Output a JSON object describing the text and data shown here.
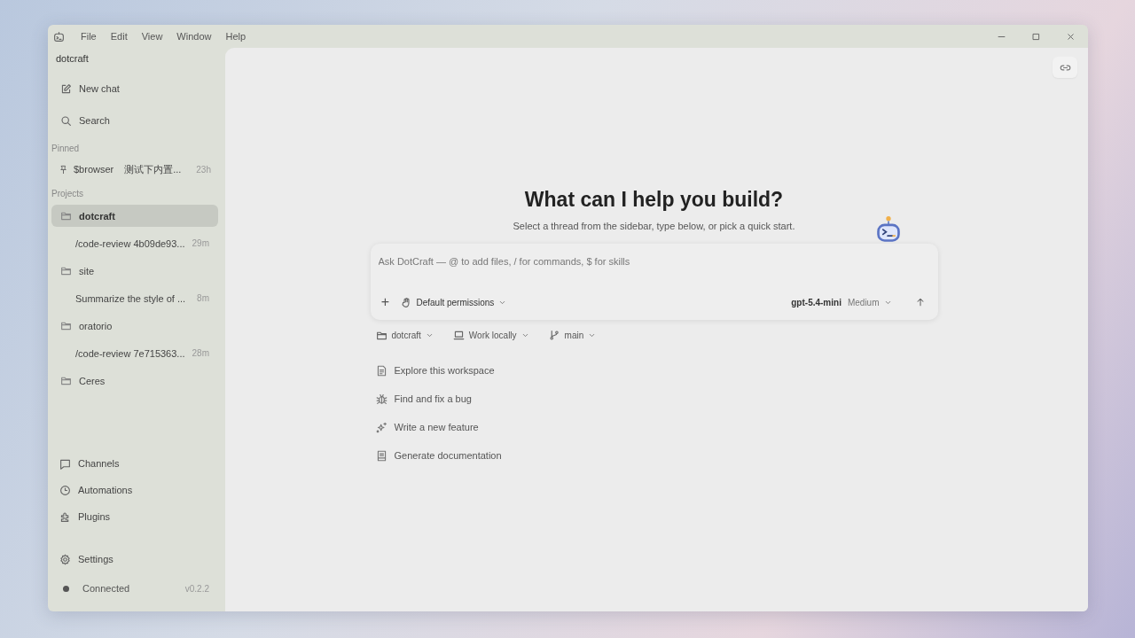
{
  "menu": [
    "File",
    "Edit",
    "View",
    "Window",
    "Help"
  ],
  "sidebar": {
    "workspace": "dotcraft",
    "actions": [
      {
        "kind": "new",
        "label": "New chat"
      },
      {
        "kind": "search",
        "label": "Search"
      }
    ],
    "pinned_label": "Pinned",
    "pinned": [
      {
        "label": "$browser",
        "preview": "测试下内置...",
        "time": "23h"
      }
    ],
    "projects_label": "Projects",
    "projects": [
      {
        "name": "dotcraft",
        "selected": true,
        "children": [
          {
            "label": "/code-review 4b09de93...",
            "time": "29m"
          }
        ]
      },
      {
        "name": "site",
        "selected": false,
        "children": [
          {
            "label": "Summarize the style of ...",
            "time": "8m"
          }
        ]
      },
      {
        "name": "oratorio",
        "selected": false,
        "children": [
          {
            "label": "/code-review 7e715363...",
            "time": "28m"
          }
        ]
      },
      {
        "name": "Ceres",
        "selected": false
      }
    ],
    "nav": [
      {
        "kind": "channels",
        "label": "Channels"
      },
      {
        "kind": "automations",
        "label": "Automations"
      },
      {
        "kind": "plugins",
        "label": "Plugins"
      }
    ],
    "settings": "Settings",
    "status": "Connected",
    "version": "v0.2.2"
  },
  "main": {
    "heading": "What can I help you build?",
    "subheading": "Select a thread from the sidebar, type below, or pick a quick start.",
    "composer": {
      "placeholder": "Ask DotCraft — @ to add files, / for commands, $ for skills",
      "add": "+",
      "permissions": "Default permissions",
      "model": "gpt-5.4-mini",
      "effort": "Medium"
    },
    "context": [
      {
        "kind": "folder",
        "label": "dotcraft"
      },
      {
        "kind": "laptop",
        "label": "Work locally"
      },
      {
        "kind": "branch",
        "label": "main"
      }
    ],
    "quick_starts": [
      {
        "kind": "doc",
        "label": "Explore this workspace"
      },
      {
        "kind": "bug",
        "label": "Find and fix a bug"
      },
      {
        "kind": "sparkle",
        "label": "Write a new feature"
      },
      {
        "kind": "book",
        "label": "Generate documentation"
      }
    ]
  }
}
